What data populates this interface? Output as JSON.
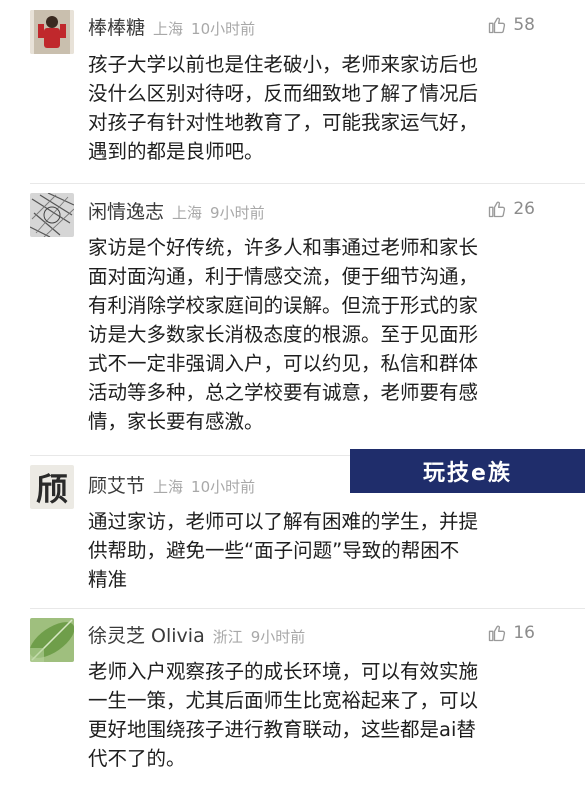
{
  "comments": [
    {
      "user": "棒棒糖",
      "location": "上海",
      "time": "10小时前",
      "likes": "58",
      "avatar": "red-figure-avatar",
      "lines": [
        "孩子大学以前也是住老破小，老师来家访后也",
        "没什么区别对待呀，反而细致地了解了情况后",
        "对孩子有针对性地教育了，可能我家运气好，",
        "遇到的都是良师吧。"
      ]
    },
    {
      "user": "闲情逸志",
      "location": "上海",
      "time": "9小时前",
      "likes": "26",
      "avatar": "sketch-avatar",
      "lines": [
        "家访是个好传统，许多人和事通过老师和家长",
        "面对面沟通，利于情感交流，便于细节沟通，",
        "有利消除学校家庭间的误解。但流于形式的家",
        "访是大多数家长消极态度的根源。至于见面形",
        "式不一定非强调入户，可以约见，私信和群体",
        "活动等多种，总之学校要有诚意，老师要有感",
        "情，家长要有感激。"
      ]
    },
    {
      "user": "顾艾节",
      "location": "上海",
      "time": "10小时前",
      "likes": "",
      "avatar": "calligraphy-avatar",
      "avatar_char": "颀",
      "lines": [
        "通过家访，老师可以了解有困难的学生，并提",
        "供帮助，避免一些“面子问题”导致的帮困不",
        "精准"
      ]
    },
    {
      "user": "徐灵芝 Olivia",
      "location": "浙江",
      "time": "9小时前",
      "likes": "16",
      "avatar": "leaf-avatar",
      "lines": [
        "老师入户观察孩子的成长环境，可以有效实施",
        "一生一策，尤其后面师生比宽裕起来了，可以",
        "更好地围绕孩子进行教育联动，这些都是ai替",
        "代不了的。"
      ]
    }
  ],
  "watermark": "玩技e族",
  "colors": {
    "watermark_bg": "#1f2d6b",
    "meta": "#a8a8a8",
    "text": "#1e1e1e"
  }
}
